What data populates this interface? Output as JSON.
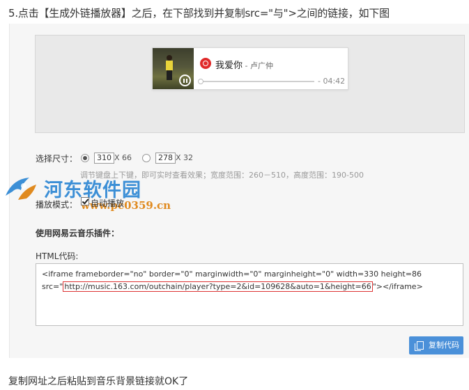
{
  "heading": "5.点击【生成外链播放器】之后，在下部找到并复制src=\"与\">之间的链接，如下图",
  "player": {
    "song_title": "我爱你",
    "song_artist": " - 卢广仲",
    "time": "- 04:42",
    "progress": 0
  },
  "size": {
    "label": "选择尺寸：",
    "option1_value": "310",
    "option1_suffix": "X 66",
    "option2_value": "278",
    "option2_suffix": "X 32",
    "hint": "调节键盘上下键，即可实时查看效果；宽度范围：260－510，高度范围：190-500"
  },
  "watermark": {
    "title": "河东软件园",
    "url": "www.pc0359.cn"
  },
  "mode": {
    "label": "播放模式：",
    "value": "自动播放"
  },
  "plugin_title": "使用网易云音乐插件：",
  "html_code_label": "HTML代码:",
  "code": {
    "line1": "<iframe frameborder=\"no\" border=\"0\" marginwidth=\"0\" marginheight=\"0\" width=330 height=86",
    "line2_prefix": "src=\"",
    "line2_url": "http://music.163.com/outchain/player?type=2&id=109628&auto=1&height=66",
    "line2_suffix": "\"></iframe>"
  },
  "copy_button": "复制代码",
  "bottom_note": "复制网址之后粘贴到音乐背景链接就OK了",
  "colors": {
    "accent_blue": "#4a90d9",
    "netease_red": "#e02a2a",
    "highlight_red": "#dd3333",
    "watermark_blue": "#3c8fd6",
    "watermark_orange": "#e08a1f"
  }
}
